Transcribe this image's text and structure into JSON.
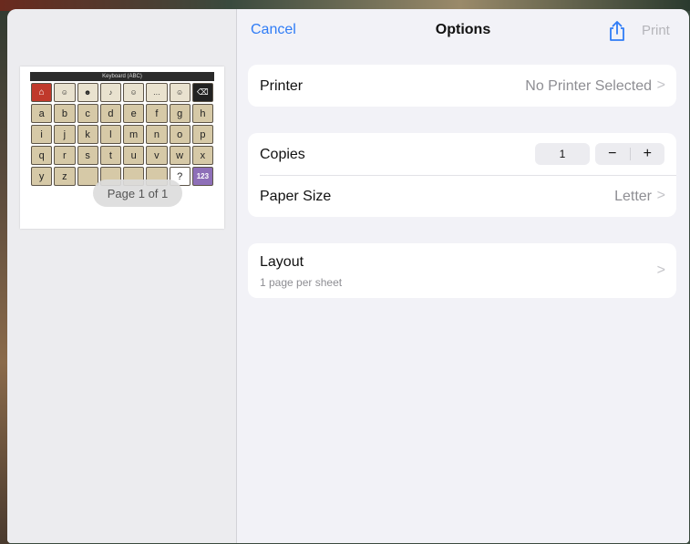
{
  "nav": {
    "cancel": "Cancel",
    "title": "Options",
    "print": "Print",
    "share_icon": "share-icon"
  },
  "preview": {
    "page_badge": "Page 1 of 1",
    "keyboard_title": "Keyboard (ABC)",
    "rows": [
      [
        "",
        "",
        "",
        "",
        "",
        "",
        "",
        ""
      ],
      [
        "a",
        "b",
        "c",
        "d",
        "e",
        "f",
        "g",
        "h"
      ],
      [
        "i",
        "j",
        "k",
        "l",
        "m",
        "n",
        "o",
        "p"
      ],
      [
        "q",
        "r",
        "s",
        "t",
        "u",
        "v",
        "w",
        "x"
      ],
      [
        "y",
        "z",
        "",
        "",
        "",
        "",
        "?",
        "123"
      ]
    ]
  },
  "printer": {
    "label": "Printer",
    "value": "No Printer Selected"
  },
  "copies": {
    "label": "Copies",
    "value": "1",
    "minus": "−",
    "plus": "+"
  },
  "paper": {
    "label": "Paper Size",
    "value": "Letter"
  },
  "layout": {
    "label": "Layout",
    "sub": "1 page per sheet"
  },
  "chevron": ">"
}
